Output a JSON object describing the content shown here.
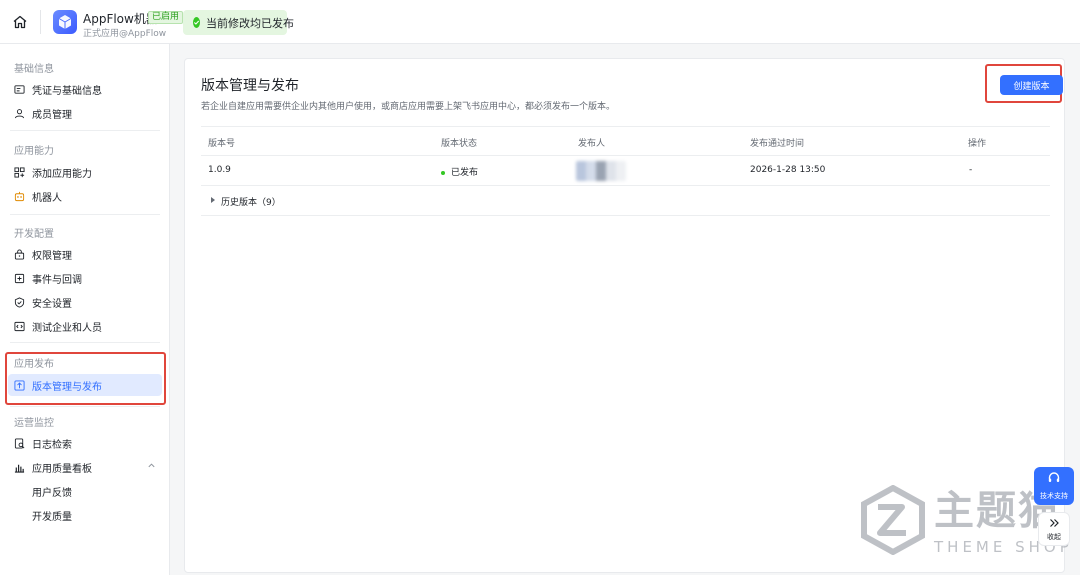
{
  "topbar": {
    "app_name": "AppFlow机器人",
    "status_tag": "已启用",
    "app_subtitle": "正式应用@AppFlow",
    "publish_status": "当前修改均已发布"
  },
  "sidebar": {
    "groups": [
      {
        "title": "基础信息",
        "items": [
          "凭证与基础信息",
          "成员管理"
        ]
      },
      {
        "title": "应用能力",
        "items": [
          "添加应用能力",
          "机器人"
        ]
      },
      {
        "title": "开发配置",
        "items": [
          "权限管理",
          "事件与回调",
          "安全设置",
          "测试企业和人员"
        ]
      },
      {
        "title": "应用发布",
        "items": [
          "版本管理与发布"
        ]
      },
      {
        "title": "运营监控",
        "items": [
          "日志检索",
          "应用质量看板",
          "用户反馈",
          "开发质量"
        ]
      }
    ],
    "active_item": "版本管理与发布"
  },
  "main": {
    "title": "版本管理与发布",
    "description": "若企业自建应用需要供企业内其他用户使用，或商店应用需要上架飞书应用中心，都必须发布一个版本。",
    "create_button": "创建版本",
    "table": {
      "columns": [
        "版本号",
        "版本状态",
        "发布人",
        "发布通过时间",
        "操作"
      ],
      "rows": [
        {
          "version": "1.0.9",
          "status": "已发布",
          "publisher": "",
          "time": "2026-1-28 13:50",
          "action": "-"
        }
      ],
      "history_label": "历史版本（9）"
    }
  },
  "floating": {
    "support_label": "技术支持",
    "collapse_label": "收起"
  },
  "watermark": {
    "text": "主题猫",
    "subtext": "THEME SHOP"
  },
  "colors": {
    "primary": "#3370ff",
    "success": "#34c724",
    "highlight_box": "#e0463c",
    "active_bg": "#e1eaff"
  }
}
